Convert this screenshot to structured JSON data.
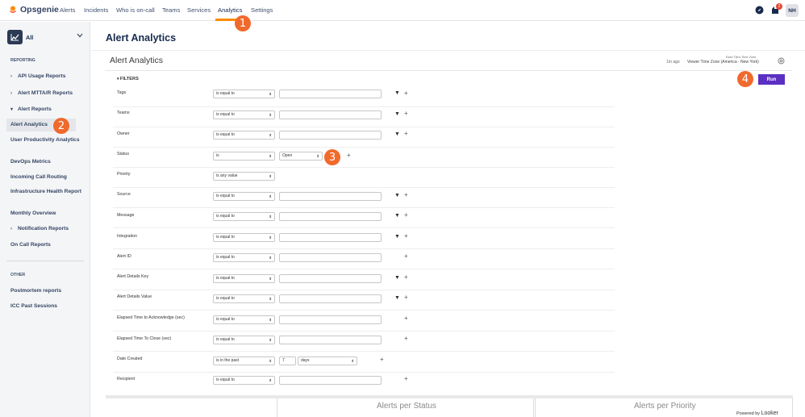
{
  "topnav": {
    "brand": "Opsgenie",
    "links": [
      "Alerts",
      "Incidents",
      "Who is on-call",
      "Teams",
      "Services",
      "Analytics",
      "Settings"
    ],
    "active": "Analytics",
    "notification_count": "2",
    "avatar_initials": "NH",
    "accent_color": "#ff8b00"
  },
  "sidebar": {
    "scope": "All",
    "reporting_heading": "REPORTING",
    "items": [
      {
        "label": "API Usage Reports",
        "caret": "›"
      },
      {
        "label": "Alert MTTA/R Reports",
        "caret": "›"
      },
      {
        "label": "Alert Reports",
        "caret": "▾"
      },
      {
        "label": "Alert Analytics",
        "selected": true
      },
      {
        "label": "User Productivity Analytics"
      },
      {
        "label": "DevOps Metrics"
      },
      {
        "label": "Incoming Call Routing"
      },
      {
        "label": "Infrastructure Health Report"
      },
      {
        "label": "Monthly Overview"
      },
      {
        "label": "Notification Reports",
        "caret": "›"
      },
      {
        "label": "On Call Reports"
      }
    ],
    "other_heading": "OTHER",
    "other_items": [
      "Postmortem reports",
      "ICC Past Sessions"
    ]
  },
  "markers": [
    "1",
    "2",
    "3",
    "4"
  ],
  "main": {
    "page_title": "Alert Analytics",
    "inner_title": "Alert Analytics",
    "timezone_note": "Each Tile's Time Zone",
    "last_run": "1m ago",
    "timezone": "Viewer Time Zone (America - New York)",
    "filters_label": "FILTERS",
    "run_label": "Run",
    "run_color": "#5a2fc2",
    "filters": [
      {
        "label": "Tags",
        "op": "is equal to",
        "value": ""
      },
      {
        "label": "Teams",
        "op": "is equal to",
        "value": ""
      },
      {
        "label": "Owner",
        "op": "is equal to",
        "value": ""
      },
      {
        "label": "Status",
        "op": "is",
        "value": "Open"
      },
      {
        "label": "Priority",
        "op": "is any value"
      },
      {
        "label": "Source",
        "op": "is equal to",
        "value": ""
      },
      {
        "label": "Message",
        "op": "is equal to",
        "value": ""
      },
      {
        "label": "Integration",
        "op": "is equal to",
        "value": ""
      },
      {
        "label": "Alert ID",
        "op": "is equal to",
        "value": ""
      },
      {
        "label": "Alert Details Key",
        "op": "is equal to",
        "value": ""
      },
      {
        "label": "Alert Details Value",
        "op": "is equal to",
        "value": ""
      },
      {
        "label": "Elapsed Time to Acknowledge (sec)",
        "op": "is equal to",
        "value": ""
      },
      {
        "label": "Elapsed Time To Close (sec)",
        "op": "is equal to",
        "value": ""
      },
      {
        "label": "Date Created",
        "op": "is in the past",
        "value": "7",
        "unit": "days"
      },
      {
        "label": "Recipient",
        "op": "is equal to",
        "value": ""
      }
    ],
    "tiles": [
      "Alerts per Status",
      "Alerts per Priority"
    ],
    "powered_by": "Powered by",
    "looker": "Looker"
  }
}
